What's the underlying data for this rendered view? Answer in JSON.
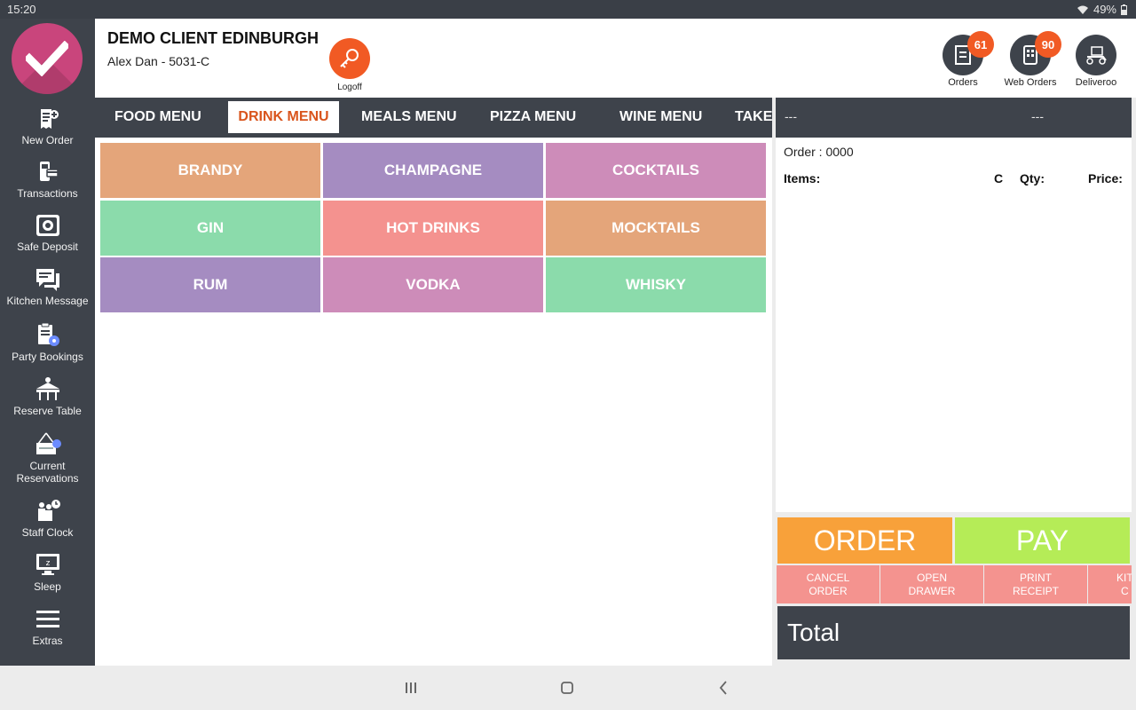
{
  "statusbar": {
    "time": "15:20",
    "battery": "49%"
  },
  "sidebar": {
    "items": [
      {
        "label": "New Order",
        "icon": "receipt-plus-icon"
      },
      {
        "label": "Transactions",
        "icon": "card-terminal-icon"
      },
      {
        "label": "Safe Deposit",
        "icon": "safe-icon"
      },
      {
        "label": "Kitchen Message",
        "icon": "chat-icon"
      },
      {
        "label": "Party Bookings",
        "icon": "clipboard-icon"
      },
      {
        "label": "Reserve Table",
        "icon": "table-icon"
      },
      {
        "label": "Current Reservations",
        "icon": "reservation-sign-icon"
      },
      {
        "label": "Staff Clock",
        "icon": "staff-clock-icon"
      },
      {
        "label": "Sleep",
        "icon": "monitor-sleep-icon"
      },
      {
        "label": "Extras",
        "icon": "hamburger-menu-icon"
      }
    ]
  },
  "header": {
    "client": "DEMO CLIENT EDINBURGH",
    "user": "Alex Dan - 5031-C",
    "logoff_label": "Logoff",
    "orders_label": "Orders",
    "orders_count": "61",
    "web_orders_label": "Web Orders",
    "web_orders_count": "90",
    "deliveroo_label": "Deliveroo"
  },
  "tabs": [
    "FOOD MENU",
    "DRINK MENU",
    "MEALS MENU",
    "PIZZA MENU",
    "WINE MENU",
    "TAKE"
  ],
  "active_tab": "DRINK MENU",
  "categories": [
    {
      "label": "BRANDY",
      "color": "#e4a57a"
    },
    {
      "label": "CHAMPAGNE",
      "color": "#a58cc1"
    },
    {
      "label": "COCKTAILS",
      "color": "#cd8cb9"
    },
    {
      "label": "GIN",
      "color": "#8bdbab"
    },
    {
      "label": "HOT DRINKS",
      "color": "#f4928f"
    },
    {
      "label": "MOCKTAILS",
      "color": "#e4a57a"
    },
    {
      "label": "RUM",
      "color": "#a58cc1"
    },
    {
      "label": "VODKA",
      "color": "#cd8cb9"
    },
    {
      "label": "WHISKY",
      "color": "#8bdbab"
    }
  ],
  "order": {
    "head_left": "---",
    "head_right": "---",
    "number": "Order : 0000",
    "col_items": "Items:",
    "col_c": "C",
    "col_qty": "Qty:",
    "col_price": "Price:"
  },
  "actions": {
    "order": "ORDER",
    "pay": "PAY",
    "cancel": "CANCEL\nORDER",
    "drawer": "OPEN\nDRAWER",
    "receipt": "PRINT\nRECEIPT",
    "kitchen": "KIT\nC",
    "total": "Total"
  },
  "colors": {
    "dark": "#3e434b",
    "accent": "#f15a24",
    "order": "#f8a13a",
    "pay": "#b5ec57",
    "action": "#f4938f"
  }
}
